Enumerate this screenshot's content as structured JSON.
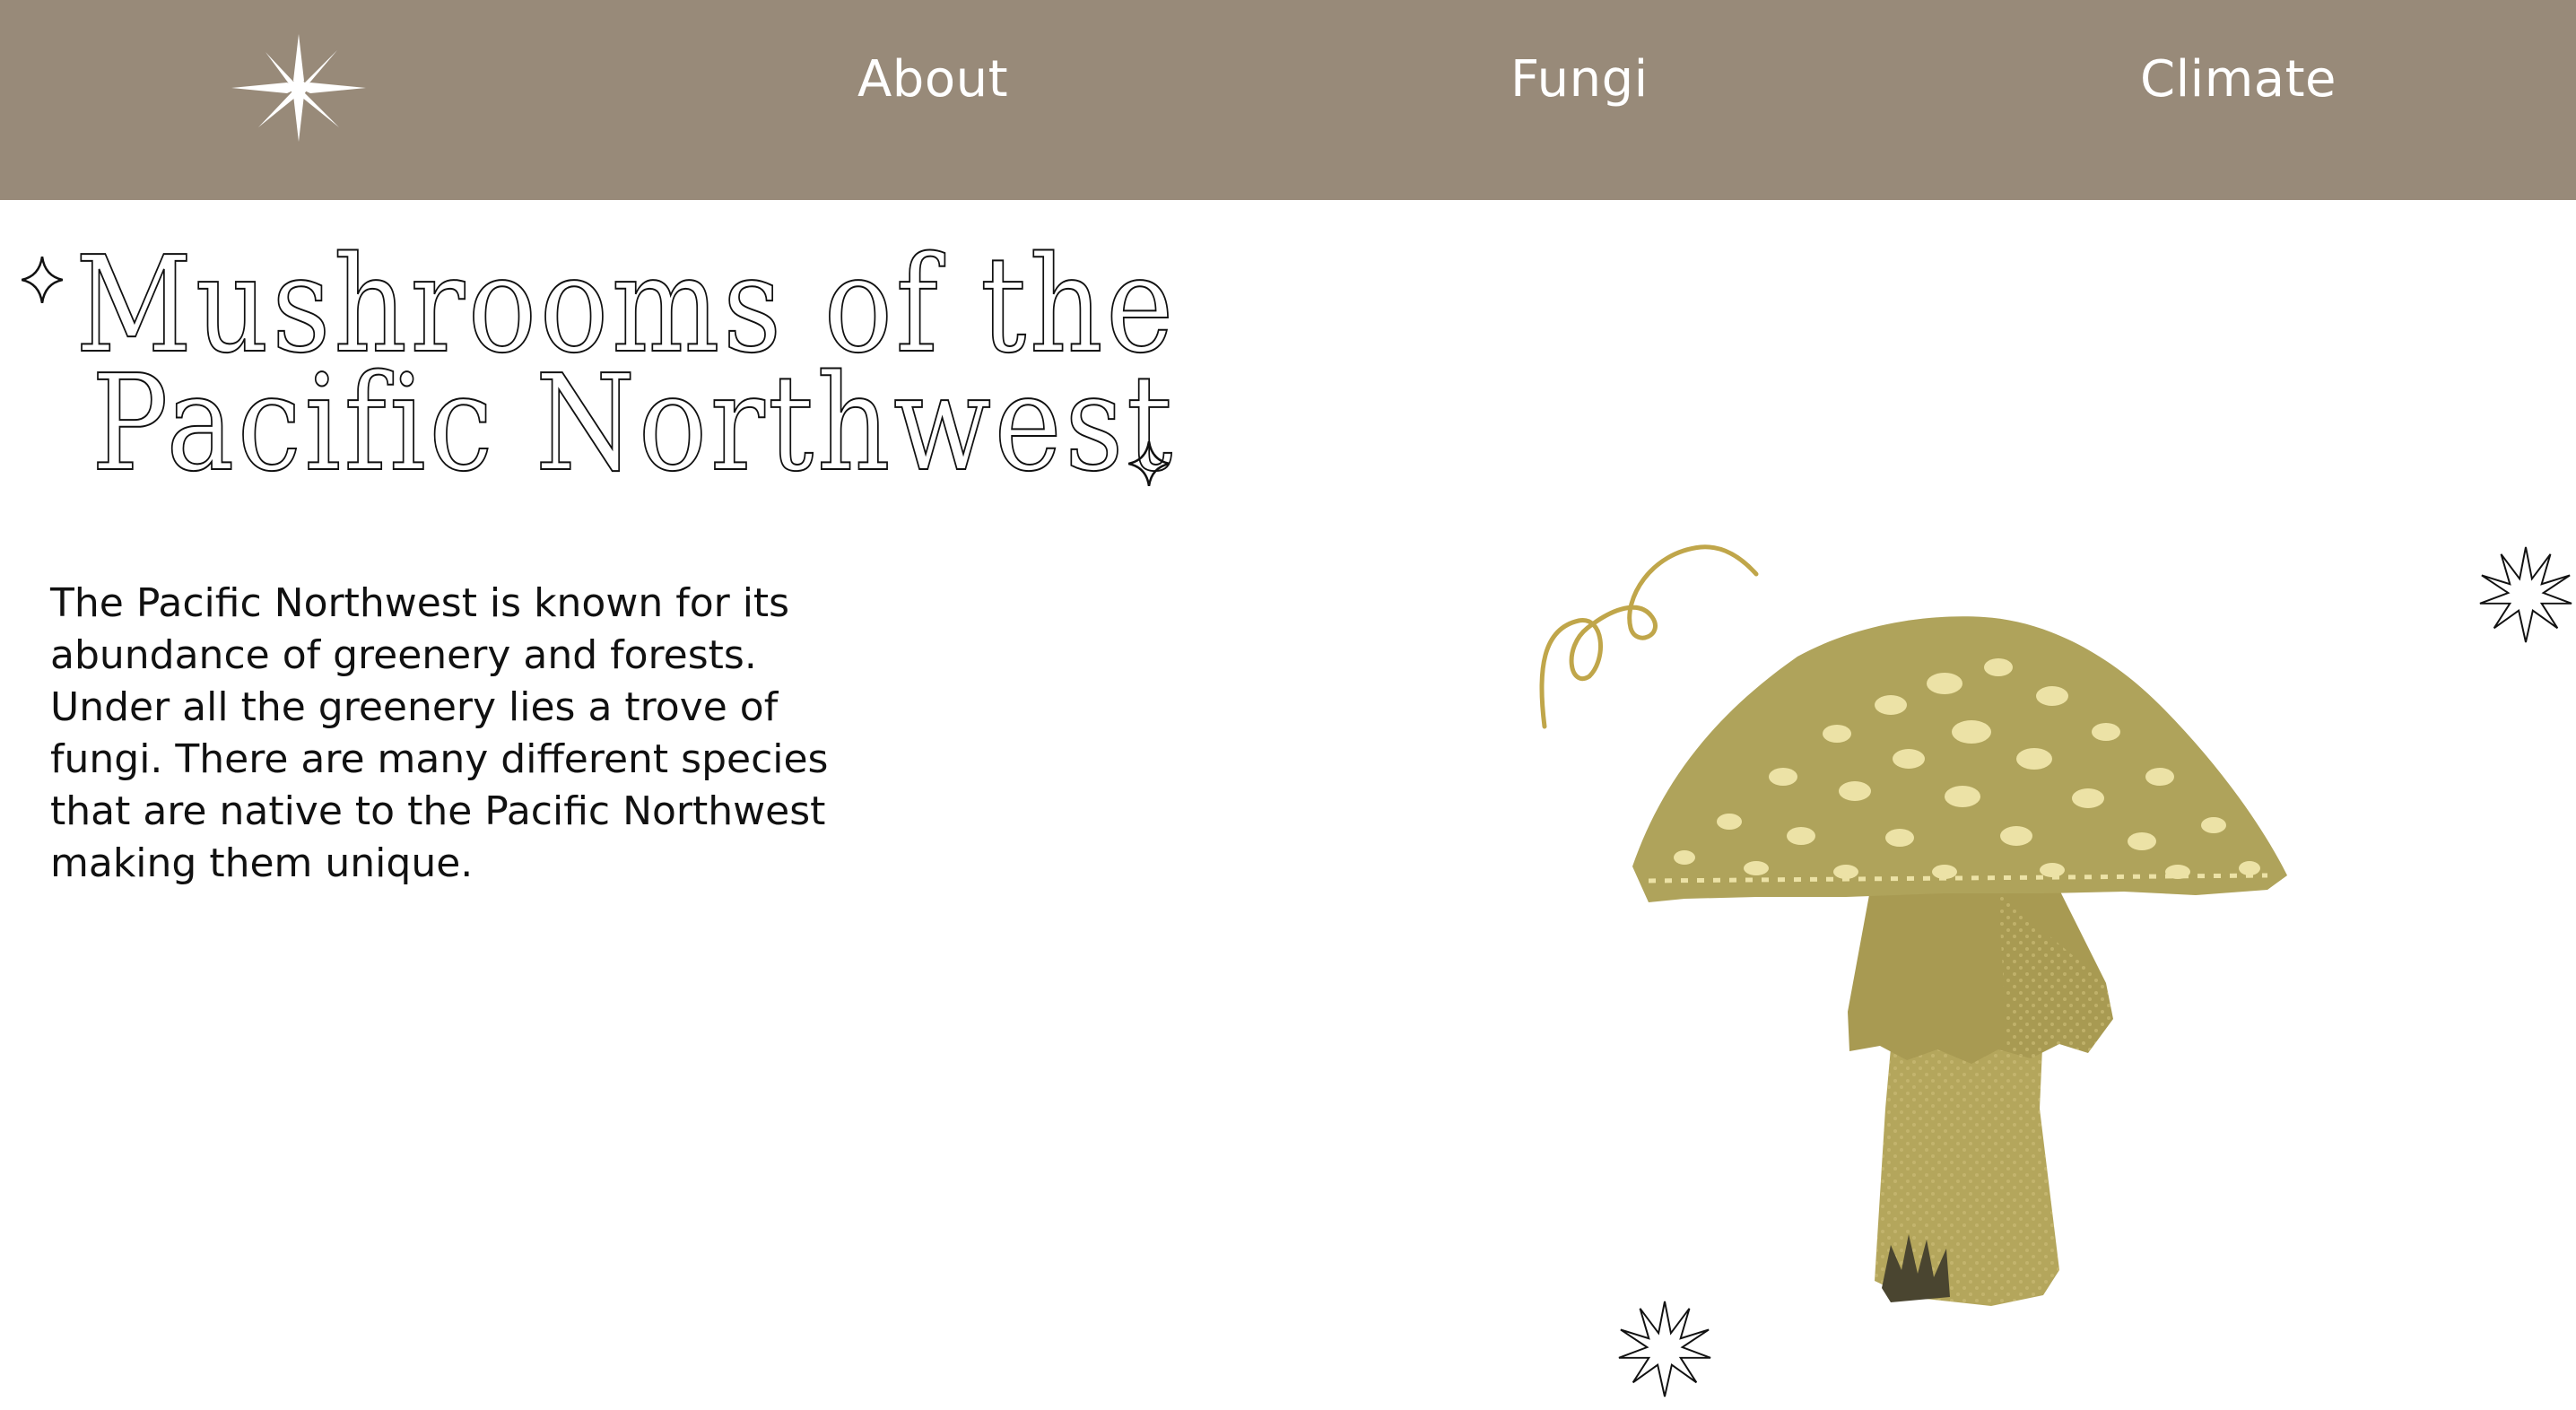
{
  "nav": {
    "logo_icon": "sparkle-star-icon",
    "links": [
      "About",
      "Fungi",
      "Climate"
    ]
  },
  "hero": {
    "title_line_1": "Mushrooms of the",
    "title_line_2": "Pacific Northwest",
    "description": "The Pacific Northwest is known for its abundance of greenery and forests. Under all the greenery lies a trove of fungi. There are many different species that are native to the Pacific Northwest making them unique."
  },
  "decorations": {
    "title_star_icons": [
      "four-point-star-icon",
      "four-point-star-icon"
    ],
    "starburst_icons": [
      "starburst-icon",
      "starburst-icon"
    ],
    "swirl_icon": "swirl-icon",
    "illustration": "mushroom-illustration"
  },
  "colors": {
    "nav_background": "#988a79",
    "mushroom": "#b8ab62",
    "swirl": "#c0a64a",
    "text": "#111111"
  }
}
